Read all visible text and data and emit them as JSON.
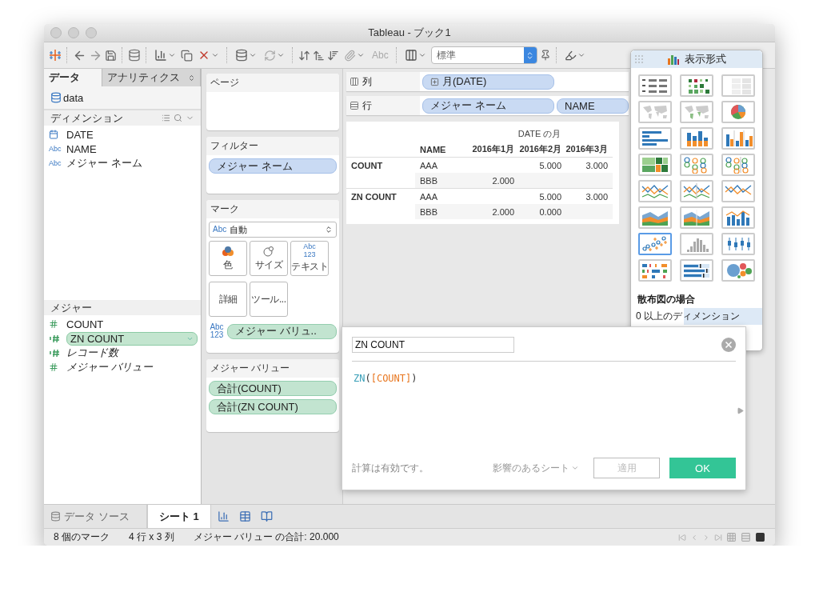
{
  "window": {
    "title": "Tableau - ブック1"
  },
  "toolbar": {
    "label_button": {
      "text": "Abc",
      "disabled": true
    },
    "fit_select": "標準"
  },
  "data_pane": {
    "tabs": [
      {
        "label": "データ",
        "selected": true
      },
      {
        "label": "アナリティクス",
        "selected": false
      }
    ],
    "datasource": "data",
    "dimensions": {
      "title": "ディメンション",
      "items": [
        {
          "name": "DATE",
          "kind": "date"
        },
        {
          "name": "NAME",
          "kind": "string",
          "type_label": "Abc"
        },
        {
          "name": "メジャー ネーム",
          "kind": "string",
          "type_label": "Abc"
        }
      ]
    },
    "measures": {
      "title": "メジャー",
      "items": [
        {
          "name": "COUNT",
          "kind": "measure",
          "italic": false,
          "selected": false
        },
        {
          "name": "ZN COUNT",
          "kind": "calculated",
          "italic": false,
          "selected": true
        },
        {
          "name": "レコード数",
          "kind": "calculated",
          "italic": true,
          "selected": false
        },
        {
          "name": "メジャー バリュー",
          "kind": "measure",
          "italic": true,
          "selected": false
        }
      ]
    }
  },
  "shelves": {
    "pages": {
      "title": "ページ"
    },
    "filters": {
      "title": "フィルター",
      "pills": [
        {
          "label": "メジャー ネーム",
          "kind": "dimension"
        }
      ]
    },
    "marks": {
      "title": "マーク",
      "type_label": "Abc",
      "mark_type": "自動",
      "buttons": [
        {
          "label": "色",
          "kind": "color"
        },
        {
          "label": "サイズ",
          "kind": "size"
        },
        {
          "label": "テキスト",
          "kind": "text",
          "icon_label": "Abc 123"
        },
        {
          "label": "詳細",
          "kind": "detail"
        },
        {
          "label": "ツール...",
          "kind": "tooltip"
        }
      ],
      "fields": [
        {
          "type_label": "Abc 123",
          "label": "メジャー バリュ..",
          "kind": "measure"
        }
      ]
    },
    "measure_values": {
      "title": "メジャー バリュー",
      "pills": [
        {
          "label": "合計(COUNT)",
          "kind": "measure"
        },
        {
          "label": "合計(ZN COUNT)",
          "kind": "measure"
        }
      ]
    },
    "columns": {
      "title": "列",
      "pills": [
        {
          "label": "月(DATE)",
          "kind": "dimension",
          "expandable": true
        }
      ]
    },
    "rows": {
      "title": "行",
      "pills": [
        {
          "label": "メジャー ネーム",
          "kind": "dimension",
          "expandable": false
        },
        {
          "label": "NAME",
          "kind": "dimension",
          "expandable": false
        }
      ]
    }
  },
  "table": {
    "column_group": "DATE の月",
    "columns": [
      "NAME",
      "2016年1月",
      "2016年2月",
      "2016年3月"
    ],
    "groups": [
      {
        "label": "COUNT",
        "rows": [
          {
            "name": "AAA",
            "values": [
              {
                "kind": "empty"
              },
              {
                "kind": "value",
                "text": "5.000"
              },
              {
                "kind": "value",
                "text": "3.000"
              }
            ]
          },
          {
            "name": "BBB",
            "values": [
              {
                "kind": "value",
                "text": "2.000"
              },
              {
                "kind": "empty"
              },
              {
                "kind": "empty"
              }
            ]
          }
        ]
      },
      {
        "label": "ZN COUNT",
        "rows": [
          {
            "name": "AAA",
            "values": [
              {
                "kind": "empty"
              },
              {
                "kind": "value",
                "text": "5.000"
              },
              {
                "kind": "value",
                "text": "3.000"
              }
            ]
          },
          {
            "name": "BBB",
            "values": [
              {
                "kind": "value",
                "text": "2.000"
              },
              {
                "kind": "value",
                "text": "0.000"
              },
              {
                "kind": "empty"
              }
            ]
          }
        ]
      }
    ]
  },
  "show_me": {
    "title": "表示形式",
    "charts": [
      {
        "kind": "text_table",
        "selected": false
      },
      {
        "kind": "heat_map",
        "selected": false
      },
      {
        "kind": "highlight_table",
        "selected": false
      },
      {
        "kind": "symbol_map",
        "selected": false
      },
      {
        "kind": "filled_map",
        "selected": false
      },
      {
        "kind": "pie",
        "selected": false
      },
      {
        "kind": "hbar",
        "selected": false
      },
      {
        "kind": "stacked_bar",
        "selected": false
      },
      {
        "kind": "side_bar",
        "selected": false
      },
      {
        "kind": "treemap",
        "selected": false
      },
      {
        "kind": "circle_view",
        "selected": false
      },
      {
        "kind": "side_circle",
        "selected": false
      },
      {
        "kind": "line_cont",
        "selected": false
      },
      {
        "kind": "line_disc",
        "selected": false
      },
      {
        "kind": "dual_line",
        "selected": false
      },
      {
        "kind": "area_cont",
        "selected": false
      },
      {
        "kind": "area_disc",
        "selected": false
      },
      {
        "kind": "dual_combo",
        "selected": false
      },
      {
        "kind": "scatter",
        "selected": true
      },
      {
        "kind": "histogram",
        "selected": false
      },
      {
        "kind": "box_plot",
        "selected": false
      },
      {
        "kind": "gantt",
        "selected": false
      },
      {
        "kind": "bullet",
        "selected": false
      },
      {
        "kind": "bubbles",
        "selected": false
      }
    ],
    "hint_title": "散布図の場合",
    "hint": "0 以上のディメンション"
  },
  "calc_dialog": {
    "name": "ZN COUNT",
    "formula": [
      {
        "text": "ZN",
        "kind": "function"
      },
      {
        "text": "(",
        "kind": "paren"
      },
      {
        "text": "[COUNT]",
        "kind": "field"
      },
      {
        "text": ")",
        "kind": "paren"
      }
    ],
    "status": "計算は有効です。",
    "sheets_menu": "影響のあるシート",
    "apply": {
      "label": "適用",
      "disabled": true
    },
    "ok": "OK"
  },
  "sheet_tabs": [
    {
      "label": "データ ソース",
      "kind": "datasource",
      "selected": false
    },
    {
      "label": "シート 1",
      "kind": "sheet",
      "selected": true
    }
  ],
  "status_bar": [
    "8 個のマーク",
    "4 行 x 3 列",
    "メジャー バリュー の合計: 20.000"
  ]
}
